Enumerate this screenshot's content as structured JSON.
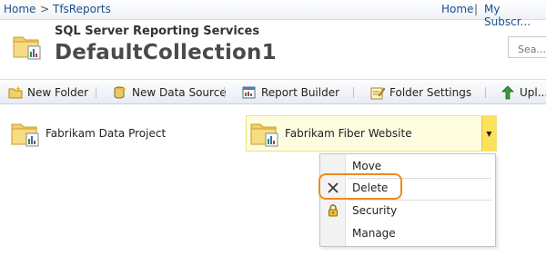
{
  "breadcrumb": {
    "home": "Home",
    "separator": ">",
    "current": "TfsReports"
  },
  "top_links": {
    "home": "Home",
    "separator": "|",
    "my_subscriptions": "My Subscr..."
  },
  "header": {
    "app_title": "SQL Server Reporting Services",
    "page_title": "DefaultCollection1"
  },
  "search": {
    "placeholder": "Sea..."
  },
  "toolbar": {
    "new_folder": "New Folder",
    "new_data_source": "New Data Source",
    "report_builder": "Report Builder",
    "folder_settings": "Folder Settings",
    "upload": "Upl..."
  },
  "items": [
    {
      "label": "Fabrikam Data Project",
      "icon": "folder-report-icon"
    },
    {
      "label": "Fabrikam Fiber Website",
      "icon": "folder-report-icon"
    }
  ],
  "context_menu": {
    "items": [
      {
        "label": "Move",
        "icon": ""
      },
      {
        "label": "Delete",
        "icon": "delete-x-icon"
      },
      {
        "label": "Security",
        "icon": "lock-icon"
      },
      {
        "label": "Manage",
        "icon": ""
      }
    ]
  },
  "colors": {
    "link": "#1c4e8c",
    "highlight_outline": "#f08a1c",
    "selected_bg": "#fffde0",
    "dropdown_button": "#fbe25a"
  }
}
